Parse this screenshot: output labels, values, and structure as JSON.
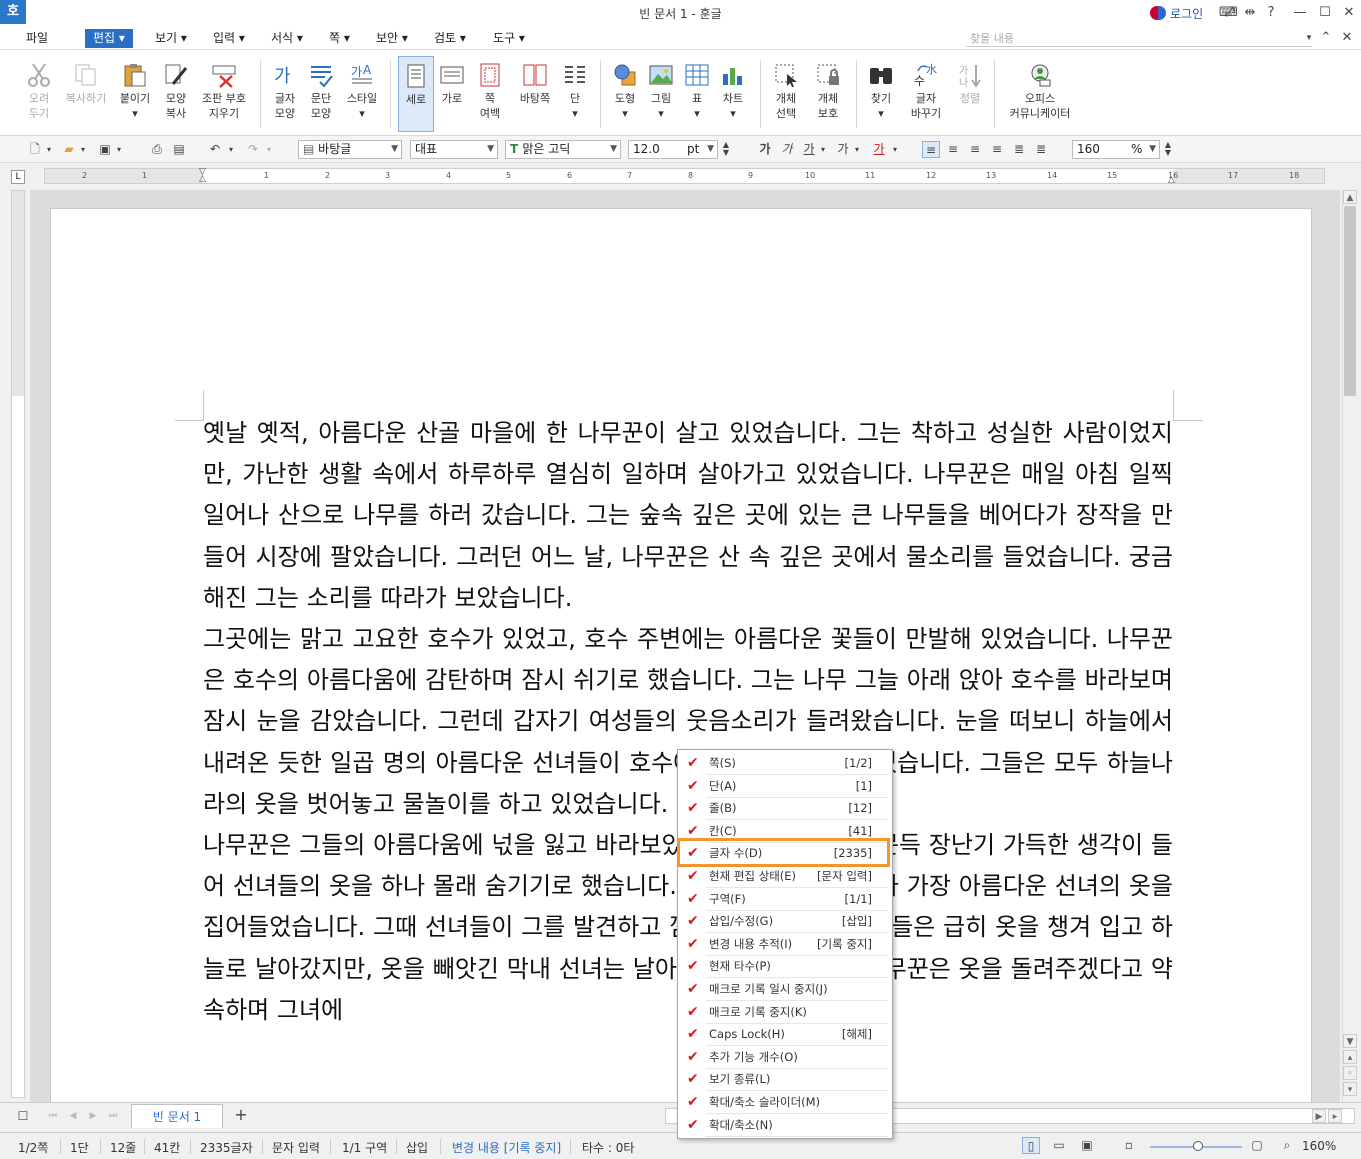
{
  "titlebar": {
    "app_icon": "호",
    "title": "빈 문서 1 - 훈글",
    "login": "로그인",
    "icons": [
      "keyboard-icon",
      "fullscreen-icon",
      "split-icon",
      "help-icon",
      "minimize-icon",
      "maximize-icon",
      "close-icon"
    ],
    "help": "?"
  },
  "menubar": {
    "items": [
      "파일",
      "편집",
      "보기",
      "입력",
      "서식",
      "쪽",
      "보안",
      "검토",
      "도구"
    ],
    "active": "편집",
    "search_placeholder": "찾을 내용"
  },
  "ribbon": {
    "buttons": [
      {
        "label1": "오려",
        "label2": "두기",
        "icon": "scissors-icon",
        "disabled": true
      },
      {
        "label1": "복사하기",
        "label2": "",
        "icon": "copy-icon",
        "disabled": true
      },
      {
        "label1": "붙이기",
        "label2": "",
        "icon": "paste-icon",
        "disabled": false
      },
      {
        "label1": "모양",
        "label2": "복사",
        "icon": "format-painter-icon",
        "disabled": false
      },
      {
        "label1": "조판 부호",
        "label2": "지우기",
        "icon": "clear-marks-icon",
        "disabled": false
      },
      {
        "label1": "글자",
        "label2": "모양",
        "icon": "char-shape-icon",
        "disabled": false
      },
      {
        "label1": "문단",
        "label2": "모양",
        "icon": "para-shape-icon",
        "disabled": false
      },
      {
        "label1": "스타일",
        "label2": "",
        "icon": "style-icon",
        "disabled": false
      },
      {
        "label1": "세로",
        "label2": "",
        "icon": "portrait-icon",
        "disabled": false
      },
      {
        "label1": "가로",
        "label2": "",
        "icon": "landscape-icon",
        "disabled": false
      },
      {
        "label1": "쪽",
        "label2": "여백",
        "icon": "page-margin-icon",
        "disabled": false
      },
      {
        "label1": "바탕쪽",
        "label2": "",
        "icon": "master-page-icon",
        "disabled": false
      },
      {
        "label1": "단",
        "label2": "",
        "icon": "columns-icon",
        "disabled": false
      },
      {
        "label1": "도형",
        "label2": "",
        "icon": "shapes-icon",
        "disabled": false
      },
      {
        "label1": "그림",
        "label2": "",
        "icon": "picture-icon",
        "disabled": false
      },
      {
        "label1": "표",
        "label2": "",
        "icon": "table-icon",
        "disabled": false
      },
      {
        "label1": "차트",
        "label2": "",
        "icon": "chart-icon",
        "disabled": false
      },
      {
        "label1": "개체",
        "label2": "선택",
        "icon": "select-object-icon",
        "disabled": false
      },
      {
        "label1": "개체",
        "label2": "보호",
        "icon": "protect-object-icon",
        "disabled": false
      },
      {
        "label1": "찾기",
        "label2": "",
        "icon": "binoculars-icon",
        "disabled": false
      },
      {
        "label1": "글자",
        "label2": "바꾸기",
        "icon": "replace-icon",
        "disabled": false
      },
      {
        "label1": "정렬",
        "label2": "",
        "icon": "sort-icon",
        "disabled": true
      },
      {
        "label1": "오피스",
        "label2": "커뮤니케이터",
        "icon": "communicator-icon",
        "disabled": false
      }
    ]
  },
  "format_toolbar": {
    "style": "바탕글",
    "lang": "대표",
    "font": "맑은 고딕",
    "size": "12.0",
    "size_unit": "pt",
    "zoom": "160",
    "zoom_unit": "%",
    "char_buttons": [
      "가",
      "가",
      "가",
      "가",
      "가"
    ]
  },
  "ruler": {
    "numbers": [
      "2",
      "1",
      "1",
      "2",
      "3",
      "4",
      "5",
      "6",
      "7",
      "8",
      "9",
      "10",
      "11",
      "12",
      "13",
      "14",
      "15",
      "16",
      "17",
      "18"
    ],
    "corner": "L"
  },
  "document": {
    "paragraphs": [
      "옛날 옛적, 아름다운 산골 마을에 한 나무꾼이 살고 있었습니다. 그는 착하고 성실한 사람이었지만, 가난한 생활 속에서 하루하루 열심히 일하며 살아가고 있었습니다. 나무꾼은 매일 아침 일찍 일어나 산으로 나무를 하러 갔습니다. 그는 숲속 깊은 곳에 있는 큰 나무들을 베어다가 장작을 만들어 시장에 팔았습니다. 그러던 어느 날, 나무꾼은 산 속 깊은 곳에서 물소리를 들었습니다. 궁금해진 그는 소리를 따라가 보았습니다.",
      "그곳에는 맑고 고요한 호수가 있었고, 호수 주변에는 아름다운 꽃들이 만발해 있었습니다. 나무꾼은 호수의 아름다움에 감탄하며 잠시 쉬기로 했습니다. 그는 나무 그늘 아래 앉아 호수를 바라보며 잠시 눈을 감았습니다. 그런데 갑자기 여성들의 웃음소리가 들려왔습니다. 눈을 떠보니 하늘에서 내려온 듯한 일곱 명의 아름다운 선녀들이 호수에서 목욕을 하고 있었습니다. 그들은 모두 하늘나라의 옷을 벗어놓고 물놀이를 하고 있었습니다.",
      "나무꾼은 그들의 아름다움에 넋을 잃고 바라보았습니다. 그러던 중, 문득 장난기 가득한 생각이 들어 선녀들의 옷을 하나 몰래 숨기기로 했습니다. 그는 살금살금 다가가 가장 아름다운 선녀의 옷을 집어들었습니다. 그때 선녀들이 그를 발견하고 깜짝 놀랐습니다. 선녀들은 급히 옷을 챙겨 입고 하늘로 날아갔지만, 옷을 빼앗긴 막내 선녀는 날아갈 수 없었습니다. 나무꾼은 옷을 돌려주겠다고 약속하며 그녀에"
    ]
  },
  "tabbar": {
    "tab_label": "빈 문서 1",
    "add": "+"
  },
  "statusbar": {
    "page": "1/2쪽",
    "column": "1단",
    "line": "12줄",
    "col": "41칸",
    "chars": "2335글자",
    "input_mode": "문자 입력",
    "section": "1/1 구역",
    "insert": "삽입",
    "track": "변경 내용 [기록 중지]",
    "keys": "타수 : 0타",
    "zoom": "160%"
  },
  "popup": {
    "items": [
      {
        "label": "쪽(S)",
        "value": "[1/2]"
      },
      {
        "label": "단(A)",
        "value": "[1]"
      },
      {
        "label": "줄(B)",
        "value": "[12]"
      },
      {
        "label": "칸(C)",
        "value": "[41]"
      },
      {
        "label": "글자 수(D)",
        "value": "[2335]"
      },
      {
        "label": "현재 편집 상태(E)",
        "value": "[문자 입력]"
      },
      {
        "label": "구역(F)",
        "value": "[1/1]"
      },
      {
        "label": "삽입/수정(G)",
        "value": "[삽입]"
      },
      {
        "label": "변경 내용 추적(I)",
        "value": "[기록 중지]"
      },
      {
        "label": "현재 타수(P)",
        "value": ""
      },
      {
        "label": "매크로 기록 일시 중지(J)",
        "value": ""
      },
      {
        "label": "매크로 기록 중지(K)",
        "value": ""
      },
      {
        "label": "Caps Lock(H)",
        "value": "[해제]"
      },
      {
        "label": "추가 기능 개수(O)",
        "value": ""
      },
      {
        "label": "보기 종류(L)",
        "value": ""
      },
      {
        "label": "확대/축소 슬라이더(M)",
        "value": ""
      },
      {
        "label": "확대/축소(N)",
        "value": ""
      }
    ],
    "checkmark": "✔",
    "highlighted": "글자 수(D)"
  },
  "colors": {
    "accent": "#2b6fc4",
    "highlight": "#f0962c",
    "check": "#d21b1b"
  }
}
